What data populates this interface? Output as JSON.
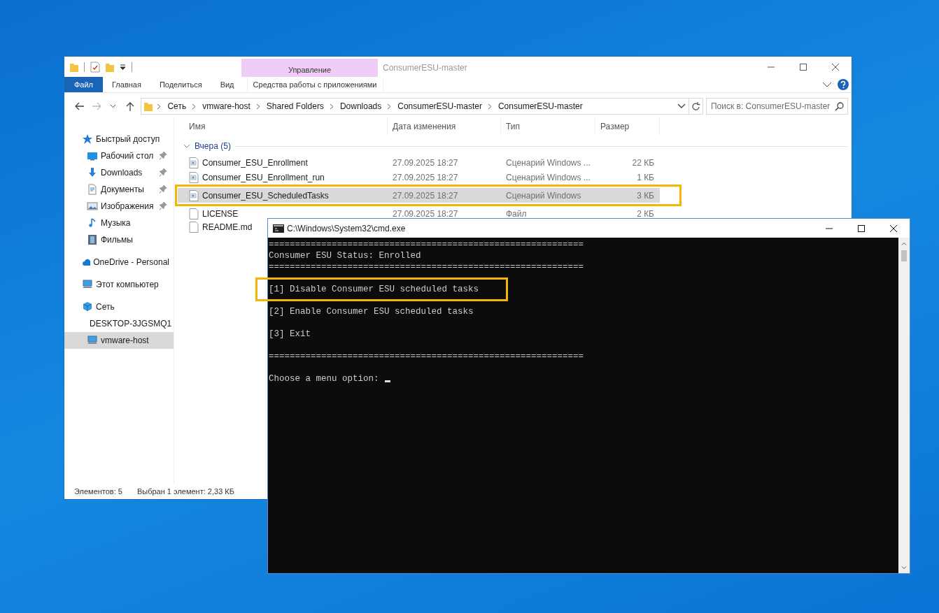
{
  "explorer": {
    "title": "ConsumerESU-master",
    "context_group": "Управление",
    "ribbon_tabs": [
      {
        "label": "Файл",
        "kind": "file"
      },
      {
        "label": "Главная",
        "kind": "tab"
      },
      {
        "label": "Поделиться",
        "kind": "tab"
      },
      {
        "label": "Вид",
        "kind": "tab"
      },
      {
        "label": "Средства работы с приложениями",
        "kind": "context"
      }
    ],
    "address": [
      "Сеть",
      "vmware-host",
      "Shared Folders",
      "Downloads",
      "ConsumerESU-master",
      "ConsumerESU-master"
    ],
    "search": {
      "placeholder": "Поиск в: ConsumerESU-master"
    },
    "nav": [
      {
        "label": "Быстрый доступ",
        "kind": "star",
        "selected": false,
        "children": [
          {
            "label": "Рабочий стол",
            "kind": "desktop",
            "pinned": true,
            "selected": false
          },
          {
            "label": "Downloads",
            "kind": "download",
            "pinned": true,
            "selected": false
          },
          {
            "label": "Документы",
            "kind": "documents",
            "pinned": true,
            "selected": false
          },
          {
            "label": "Изображения",
            "kind": "pictures",
            "pinned": true,
            "selected": false
          },
          {
            "label": "Музыка",
            "kind": "music",
            "pinned": false,
            "selected": false
          },
          {
            "label": "Фильмы",
            "kind": "videos",
            "pinned": false,
            "selected": false
          }
        ]
      },
      {
        "label": "OneDrive - Personal",
        "kind": "cloud",
        "selected": false
      },
      {
        "label": "Этот компьютер",
        "kind": "computer",
        "selected": false
      },
      {
        "label": "Сеть",
        "kind": "network",
        "selected": false,
        "children": [
          {
            "label": "DESKTOP-3JGSMQ1",
            "kind": "computer",
            "pinned": false,
            "selected": false
          },
          {
            "label": "vmware-host",
            "kind": "computer",
            "pinned": false,
            "selected": true
          }
        ]
      }
    ],
    "columns": [
      "Имя",
      "Дата изменения",
      "Тип",
      "Размер"
    ],
    "group": {
      "label": "Вчера (5)",
      "expanded": true
    },
    "files": [
      {
        "name": "Consumer_ESU_Enrollment",
        "date": "27.09.2025 18:27",
        "type": "Сценарий Windows ...",
        "size": "22 КБ",
        "kind": "script",
        "selected": false,
        "highlighted": false
      },
      {
        "name": "Consumer_ESU_Enrollment_run",
        "date": "27.09.2025 18:27",
        "type": "Сценарий Windows ...",
        "size": "1 КБ",
        "kind": "script",
        "selected": false,
        "highlighted": false
      },
      {
        "name": "Consumer_ESU_ScheduledTasks",
        "date": "27.09.2025 18:27",
        "type": "Сценарий Windows",
        "size": "3 КБ",
        "kind": "script",
        "selected": true,
        "highlighted": true
      },
      {
        "name": "LICENSE",
        "date": "27.09.2025 18:27",
        "type": "Файл",
        "size": "2 КБ",
        "kind": "file",
        "selected": false,
        "highlighted": false
      },
      {
        "name": "README.md",
        "kind": "file",
        "selected": false,
        "highlighted": false
      }
    ],
    "status": [
      "Элементов: 5",
      "Выбран 1 элемент: 2,33 КБ"
    ]
  },
  "console": {
    "title": "C:\\Windows\\System32\\cmd.exe",
    "lines": [
      {
        "kind": "text",
        "text": "============================================================"
      },
      {
        "kind": "text",
        "text": "Consumer ESU Status: Enrolled"
      },
      {
        "kind": "text",
        "text": "============================================================"
      },
      {
        "kind": "blank"
      },
      {
        "kind": "highlighted",
        "text": "[1] Disable Consumer ESU scheduled tasks"
      },
      {
        "kind": "blank"
      },
      {
        "kind": "text",
        "text": "[2] Enable Consumer ESU scheduled tasks"
      },
      {
        "kind": "blank"
      },
      {
        "kind": "text",
        "text": "[3] Exit"
      },
      {
        "kind": "blank"
      },
      {
        "kind": "text",
        "text": "============================================================"
      },
      {
        "kind": "blank"
      },
      {
        "kind": "prompt",
        "text": "Choose a menu option:"
      }
    ]
  }
}
